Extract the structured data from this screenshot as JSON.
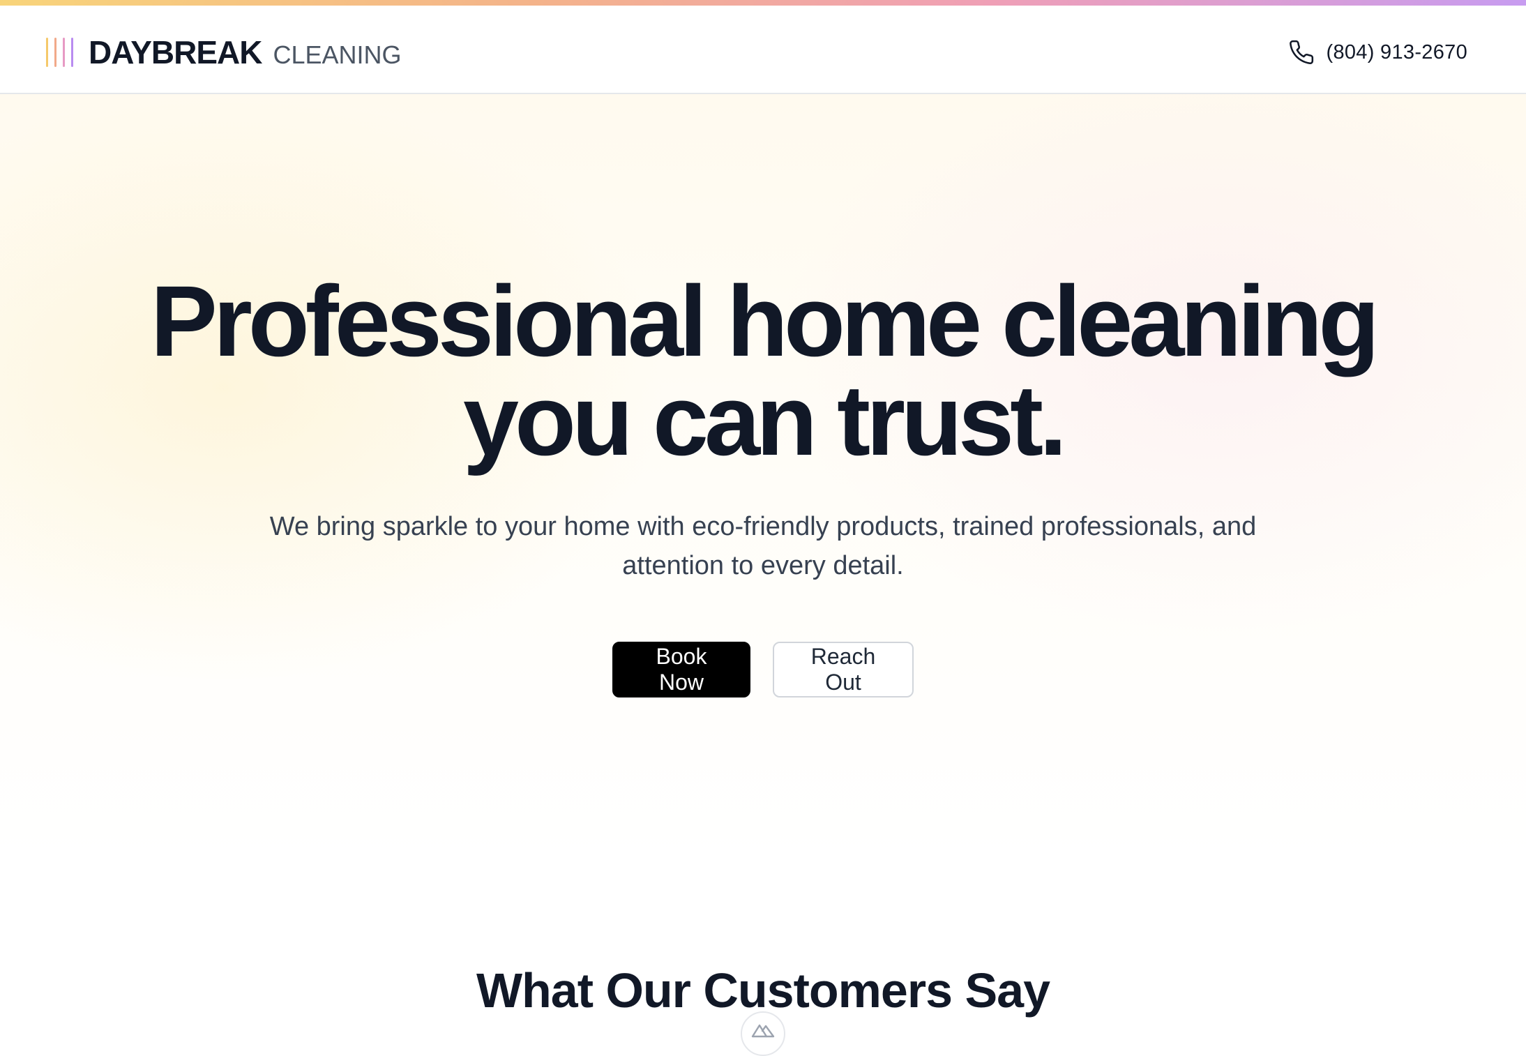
{
  "header": {
    "brand": "DAYBREAK",
    "brand_sub": "CLEANING",
    "phone": "(804) 913-2670",
    "logo_bar_colors": [
      "#f5c96b",
      "#f1a98a",
      "#e79ac4",
      "#b98cf0"
    ],
    "phone_icon": "phone-icon"
  },
  "hero": {
    "title_line1": "Professional home cleaning",
    "title_line2": "you can trust.",
    "subtitle": "We bring sparkle to your home with eco-friendly products, trained professionals, and attention to every detail.",
    "primary_cta": "Book Now",
    "secondary_cta": "Reach Out"
  },
  "testimonials": {
    "title": "What Our Customers Say"
  },
  "floating_badge": {
    "icon": "mountain-logo-icon"
  }
}
